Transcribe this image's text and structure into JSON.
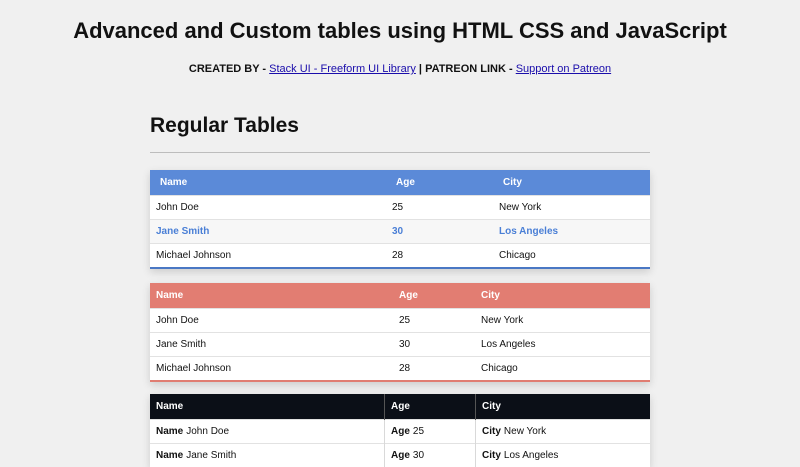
{
  "header": {
    "title": "Advanced and Custom tables using HTML CSS and JavaScript",
    "created_by_label": "CREATED BY -",
    "created_by_link": "Stack UI - Freeform UI Library",
    "separator": "|",
    "patreon_label": "PATREON LINK -",
    "patreon_link": "Support on Patreon"
  },
  "section": {
    "title": "Regular Tables"
  },
  "tables": [
    {
      "headers": [
        "Name",
        "Age",
        "City"
      ],
      "rows": [
        [
          "John Doe",
          "25",
          "New York"
        ],
        [
          "Jane Smith",
          "30",
          "Los Angeles"
        ],
        [
          "Michael Johnson",
          "28",
          "Chicago"
        ]
      ]
    },
    {
      "headers": [
        "Name",
        "Age",
        "City"
      ],
      "rows": [
        [
          "John Doe",
          "25",
          "New York"
        ],
        [
          "Jane Smith",
          "30",
          "Los Angeles"
        ],
        [
          "Michael Johnson",
          "28",
          "Chicago"
        ]
      ]
    },
    {
      "headers": [
        "Name",
        "Age",
        "City"
      ],
      "rows": [
        [
          "John Doe",
          "25",
          "New York"
        ],
        [
          "Jane Smith",
          "30",
          "Los Angeles"
        ]
      ]
    }
  ],
  "colors": {
    "blue_header": "#5b8ad8",
    "blue_highlight_text": "#4a7fd6",
    "red_header": "#e27d72",
    "dark_header": "#0b0f17",
    "background": "#f0f0f0"
  }
}
